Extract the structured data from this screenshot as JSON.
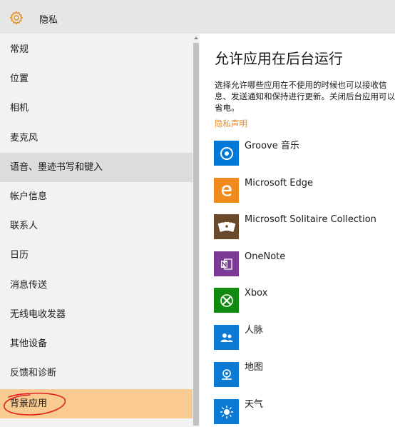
{
  "window": {
    "title": "隐私"
  },
  "sidebar": {
    "items": [
      {
        "label": "常规"
      },
      {
        "label": "位置"
      },
      {
        "label": "相机"
      },
      {
        "label": "麦克风"
      },
      {
        "label": "语音、墨迹书写和键入"
      },
      {
        "label": "帐户信息"
      },
      {
        "label": "联系人"
      },
      {
        "label": "日历"
      },
      {
        "label": "消息传送"
      },
      {
        "label": "无线电收发器"
      },
      {
        "label": "其他设备"
      },
      {
        "label": "反馈和诊断"
      },
      {
        "label": "背景应用"
      }
    ],
    "hovered_index": 4,
    "selected_index": 12
  },
  "main": {
    "heading": "允许应用在后台运行",
    "description": "选择允许哪些应用在不使用的时候也可以接收信息、发送通知和保持进行更新。关闭后台应用可以省电。",
    "privacy_link": "隐私声明",
    "apps": [
      {
        "name": "Groove 音乐",
        "icon": "groove-music-icon",
        "color": "#0078d7"
      },
      {
        "name": "Microsoft Edge",
        "icon": "edge-icon",
        "color": "#ef8a1c"
      },
      {
        "name": "Microsoft Solitaire Collection",
        "icon": "solitaire-cards-icon",
        "color": "#6b4a2b"
      },
      {
        "name": "OneNote",
        "icon": "onenote-icon",
        "color": "#7b3a96"
      },
      {
        "name": "Xbox",
        "icon": "xbox-icon",
        "color": "#108a10"
      },
      {
        "name": "人脉",
        "icon": "people-icon",
        "color": "#0a7ad5"
      },
      {
        "name": "地图",
        "icon": "maps-icon",
        "color": "#0a7ad5"
      },
      {
        "name": "天气",
        "icon": "weather-icon",
        "color": "#0a7ad5"
      }
    ]
  },
  "colors": {
    "accent": "#e58a1f",
    "selected_bg": "#f9cb90",
    "annotation": "#e0201f"
  }
}
